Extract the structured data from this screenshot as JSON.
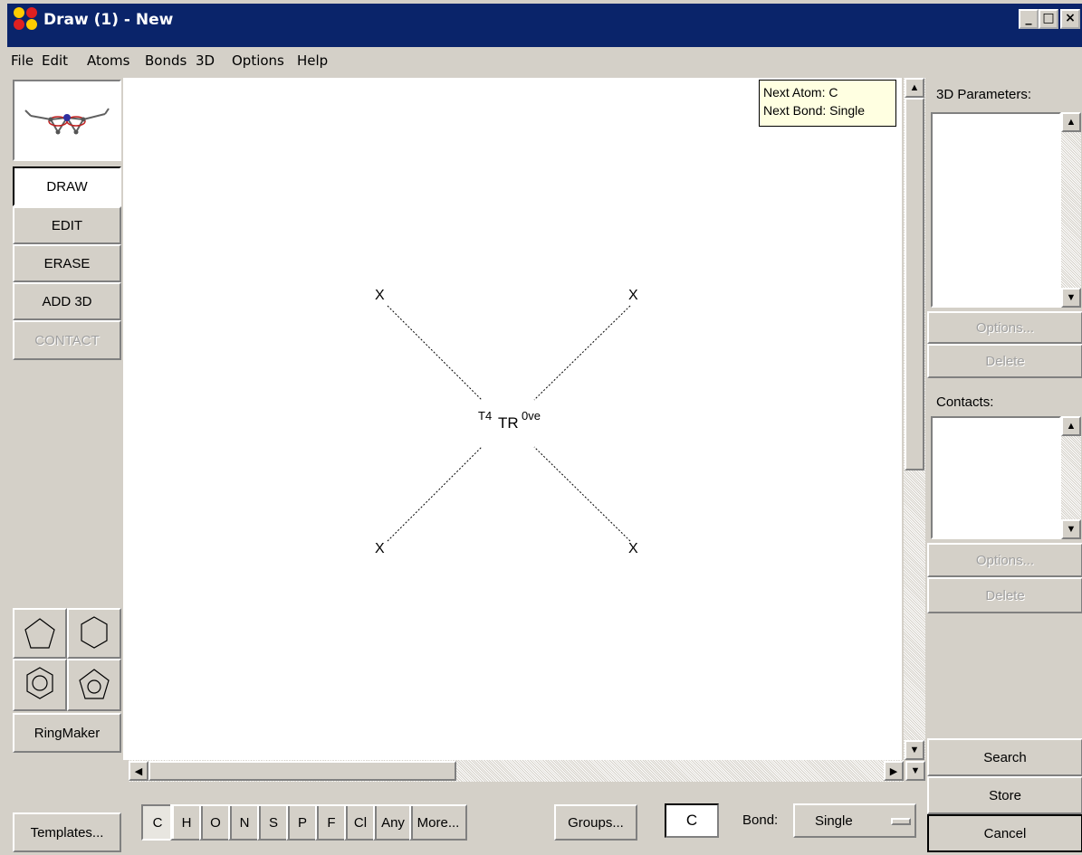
{
  "window": {
    "title": "Draw (1) - New",
    "controls": [
      "_",
      "□",
      "×"
    ]
  },
  "menu": [
    "File",
    "Edit",
    "Atoms",
    "Bonds",
    "3D",
    "Options",
    "Help"
  ],
  "tools": {
    "draw": "DRAW",
    "edit": "EDIT",
    "erase": "ERASE",
    "add3d": "ADD 3D",
    "contact": "CONTACT",
    "ringmaker": "RingMaker",
    "templates": "Templates..."
  },
  "tooltip": {
    "line1": "Next Atom: C",
    "line2": "Next Bond: Single"
  },
  "molecule": {
    "center_label": "TR",
    "left_super": "T4",
    "right_super": "0ve",
    "terminal_label": "X"
  },
  "right_panel": {
    "params_label": "3D Parameters:",
    "params_options": "Options...",
    "params_delete": "Delete",
    "contacts_label": "Contacts:",
    "contacts_options": "Options...",
    "contacts_delete": "Delete",
    "search": "Search",
    "store": "Store",
    "cancel": "Cancel"
  },
  "palette": {
    "elements": [
      "C",
      "H",
      "O",
      "N",
      "S",
      "P",
      "F",
      "Cl",
      "Any",
      "More...",
      "Groups..."
    ],
    "selected": "C",
    "current_atom": "C",
    "bond_label": "Bond:",
    "bond_value": "Single"
  },
  "colors": {
    "titlebar": "#0a246a",
    "face": "#d4d0c8",
    "tooltip_bg": "#ffffe1"
  }
}
